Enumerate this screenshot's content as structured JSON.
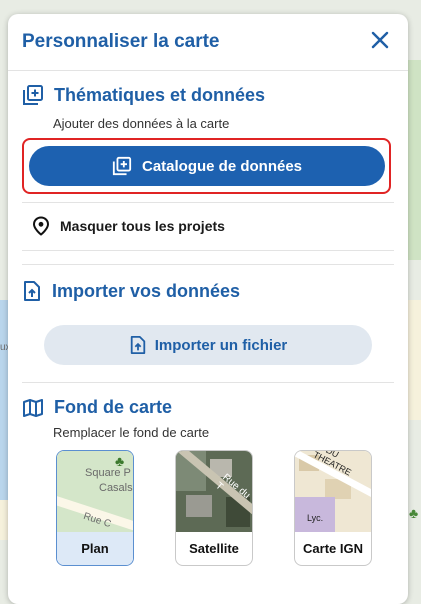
{
  "panel": {
    "title": "Personnaliser la carte",
    "close_icon": "close-icon"
  },
  "thematics": {
    "title": "Thématiques et données",
    "subtitle": "Ajouter des données à la carte",
    "catalog_button": "Catalogue de données",
    "hide_projects": "Masquer tous les projets"
  },
  "import": {
    "title": "Importer vos données",
    "button": "Importer un fichier"
  },
  "basemap": {
    "title": "Fond de carte",
    "subtitle": "Remplacer le fond de carte",
    "options": [
      {
        "label": "Plan",
        "selected": true,
        "thumb_texts": [
          "Square P",
          "Casals",
          "Rue C"
        ]
      },
      {
        "label": "Satellite",
        "selected": false,
        "thumb_texts": [
          "Rue du T"
        ]
      },
      {
        "label": "Carte IGN",
        "selected": false,
        "thumb_texts": [
          "R DU THEATRE",
          "Lyc."
        ]
      }
    ]
  },
  "map_labels": [
    "ux"
  ],
  "colors": {
    "accent": "#1f5fa6",
    "primary_button": "#1d61b0",
    "highlight_border": "#e02424",
    "secondary_button": "#e1e8f0",
    "selected_tile": "#dde9f7"
  }
}
